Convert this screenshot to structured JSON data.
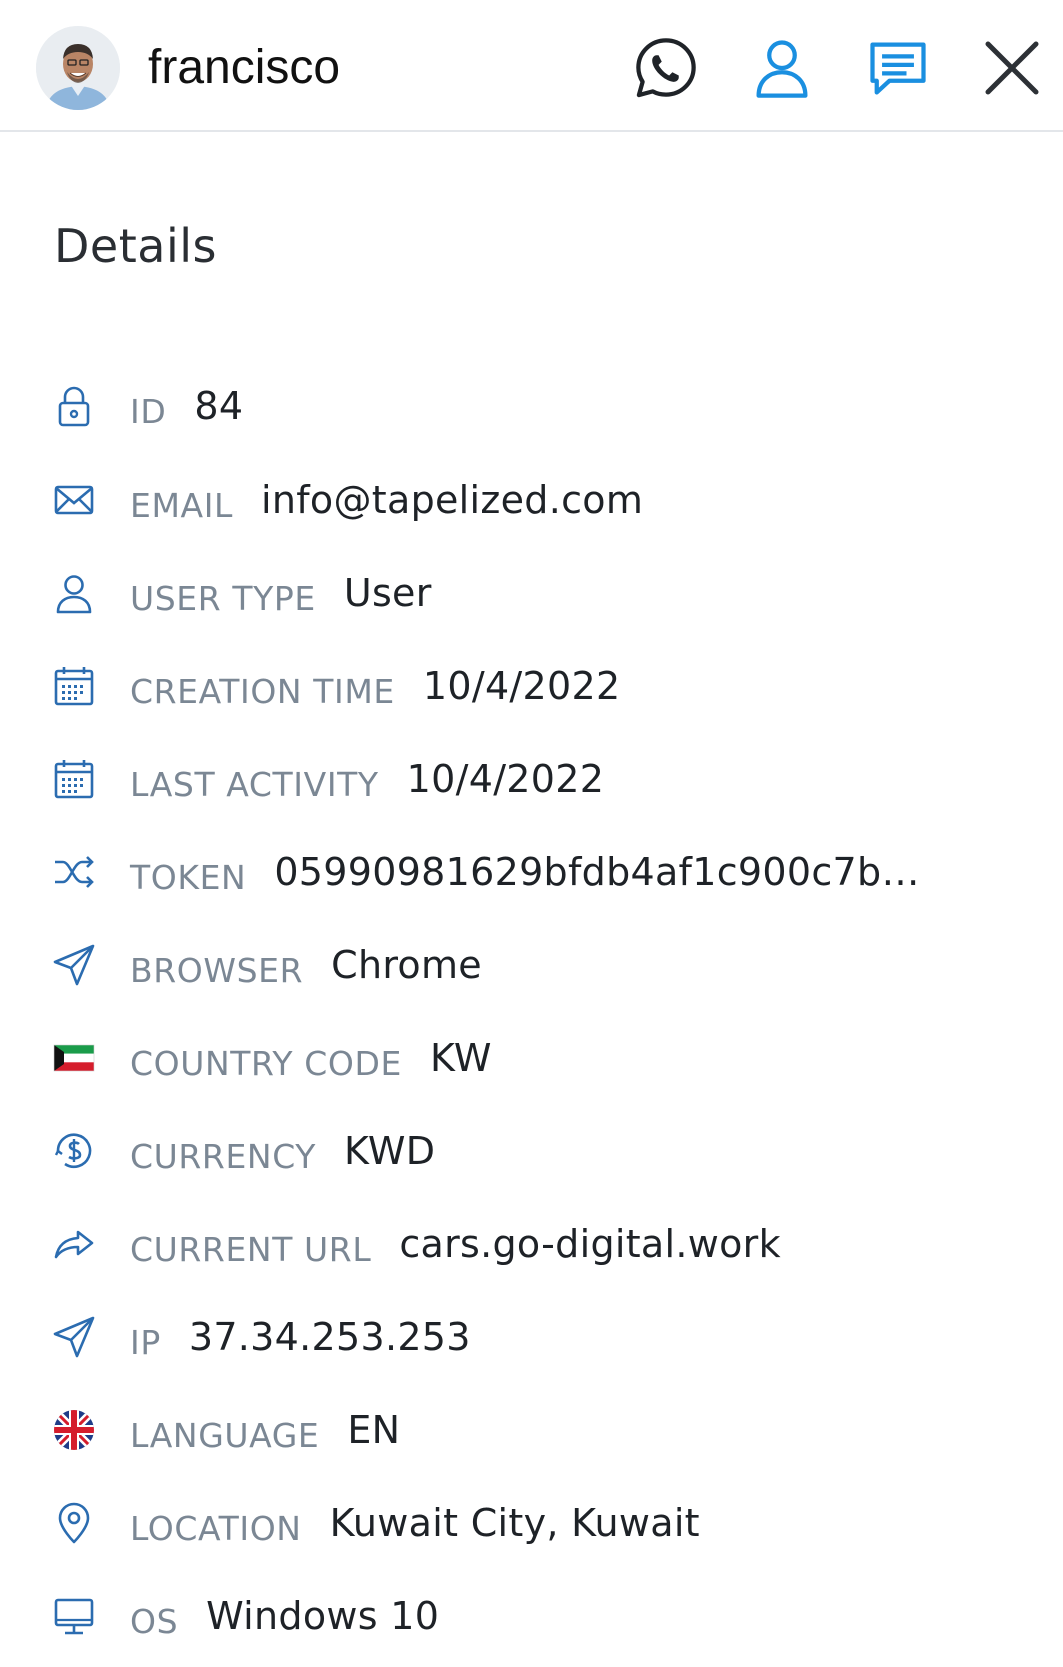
{
  "header": {
    "user_name": "francisco",
    "actions": [
      {
        "name": "whatsapp-icon"
      },
      {
        "name": "profile-icon"
      },
      {
        "name": "chat-icon"
      },
      {
        "name": "close-icon"
      }
    ]
  },
  "section_title": "Details",
  "details": [
    {
      "label": "ID",
      "value": "84",
      "icon": "lock-icon"
    },
    {
      "label": "EMAIL",
      "value": "info@tapelized.com",
      "icon": "envelope-icon"
    },
    {
      "label": "USER TYPE",
      "value": "User",
      "icon": "user-icon"
    },
    {
      "label": "CREATION TIME",
      "value": "10/4/2022",
      "icon": "calendar-icon"
    },
    {
      "label": "LAST ACTIVITY",
      "value": "10/4/2022",
      "icon": "calendar-icon"
    },
    {
      "label": "TOKEN",
      "value": "05990981629bfdb4af1c900c7b9...",
      "icon": "shuffle-icon"
    },
    {
      "label": "BROWSER",
      "value": "Chrome",
      "icon": "send-icon"
    },
    {
      "label": "COUNTRY CODE",
      "value": "KW",
      "icon": "kuwait-flag-icon"
    },
    {
      "label": "CURRENCY",
      "value": "KWD",
      "icon": "currency-icon"
    },
    {
      "label": "CURRENT URL",
      "value": "cars.go-digital.work",
      "icon": "share-arrow-icon"
    },
    {
      "label": "IP",
      "value": "37.34.253.253",
      "icon": "send-icon"
    },
    {
      "label": "LANGUAGE",
      "value": "EN",
      "icon": "uk-flag-icon"
    },
    {
      "label": "LOCATION",
      "value": "Kuwait City, Kuwait",
      "icon": "location-pin-icon"
    },
    {
      "label": "OS",
      "value": "Windows 10",
      "icon": "monitor-icon"
    }
  ],
  "colors": {
    "accent": "#1a8fe0",
    "icon_stroke": "#2b6cb0",
    "label": "#7b8794",
    "divider": "#e3e6ea"
  }
}
